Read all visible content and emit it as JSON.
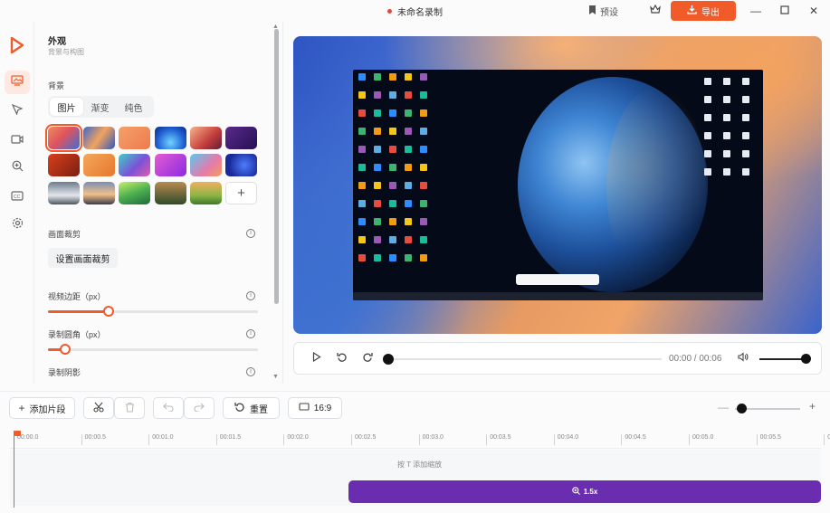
{
  "titlebar": {
    "title": "未命名录制",
    "preset_label": "预设",
    "export_label": "导出",
    "accent": "#f15a29"
  },
  "sidebar": {
    "items": [
      {
        "name": "appearance",
        "icon": "image-frame-icon",
        "active": true
      },
      {
        "name": "cursor",
        "icon": "cursor-arrow-icon",
        "active": false
      },
      {
        "name": "camera",
        "icon": "camera-icon",
        "active": false
      },
      {
        "name": "zoom",
        "icon": "zoom-in-icon",
        "active": false
      },
      {
        "name": "captions",
        "icon": "captions-icon",
        "active": false
      },
      {
        "name": "settings",
        "icon": "gear-icon",
        "active": false
      }
    ]
  },
  "panel": {
    "title": "外观",
    "subtitle": "背景与构图",
    "background_label": "背景",
    "tabs": [
      "图片",
      "渐变",
      "纯色"
    ],
    "active_tab": 0,
    "crop_label": "画面裁剪",
    "crop_button": "设置画面裁剪",
    "padding_label": "视频边距（px）",
    "padding_value": 0.29,
    "radius_label": "录制圆角（px）",
    "radius_value": 0.08,
    "shadow_label": "录制阴影"
  },
  "player": {
    "time": "00:00 / 00:06",
    "progress": 0,
    "volume": 1.0
  },
  "toolbar": {
    "add_clip": "添加片段",
    "reset": "重置",
    "aspect": "16:9"
  },
  "timeline": {
    "ticks": [
      "00:00.0",
      "00:00.5",
      "00:01.0",
      "00:01.5",
      "00:02.0",
      "00:02.5",
      "00:03.0",
      "00:03.5",
      "00:04.0",
      "00:04.5",
      "00:05.0",
      "00:05.5",
      "00:06.0"
    ],
    "hint": "按 T 添加缩放",
    "zoom_clip_label": "1.5x"
  }
}
